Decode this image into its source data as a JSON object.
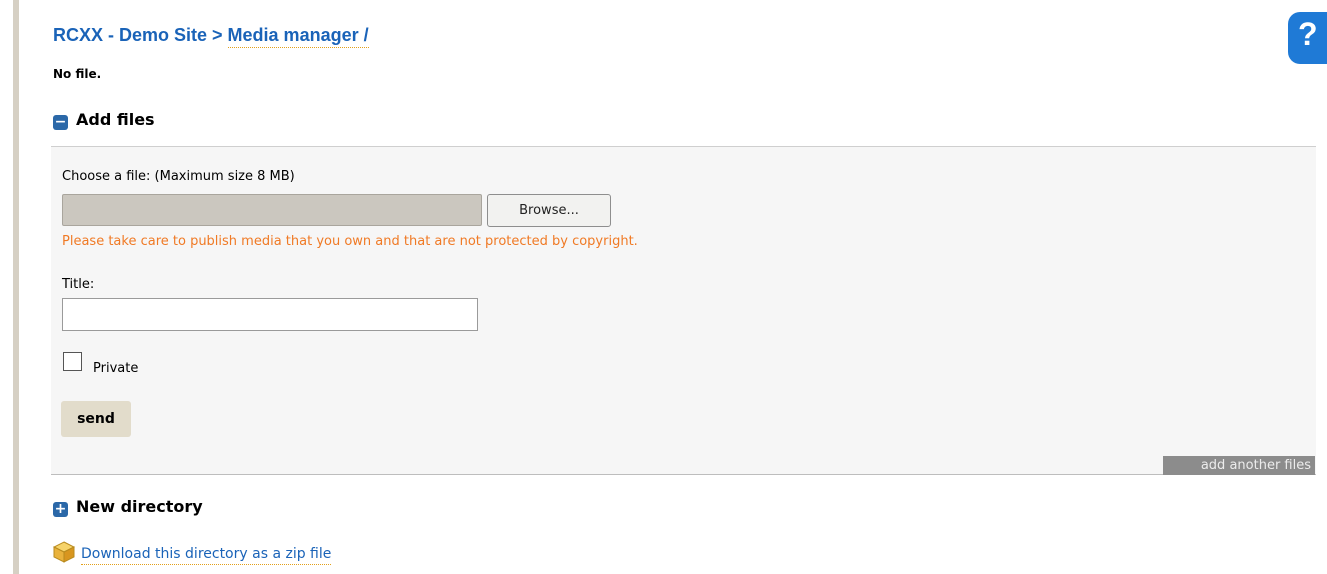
{
  "header": {
    "site": "RCXX - Demo Site",
    "separator": " > ",
    "current": "Media manager /"
  },
  "status": "No file.",
  "add_files": {
    "heading": "Add files",
    "choose_label": "Choose a file: (Maximum size 8 MB)",
    "file_value": "",
    "browse_label": "Browse...",
    "warning": "Please take care to publish media that you own and that are not protected by copyright.",
    "title_label": "Title:",
    "title_value": "",
    "private_label": "Private",
    "private_checked": false,
    "send_label": "send",
    "add_another_label": "add another files"
  },
  "new_directory": {
    "heading": "New directory"
  },
  "download": {
    "label": "Download this directory as a zip file"
  },
  "help": {
    "label": "?"
  },
  "colors": {
    "link": "#1a63b8",
    "warning": "#f07a25",
    "icon_blue": "#2b68a8",
    "help_blue": "#1f7ad6"
  },
  "icons": {
    "collapse": "minus-square-icon",
    "expand": "plus-square-icon",
    "zip": "box-icon",
    "help": "question-mark-icon"
  }
}
